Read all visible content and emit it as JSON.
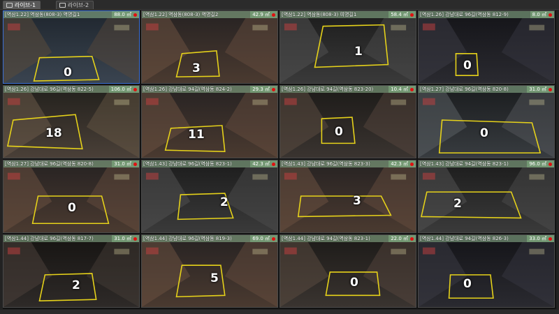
{
  "tabs": [
    {
      "label": "라이브-1",
      "active": true
    },
    {
      "label": "라이브-2",
      "active": false
    }
  ],
  "cameras": [
    {
      "name": "[역삼1.22] 역삼동(808-3) 역명길1",
      "area": "88.0 ㎡",
      "count": "0"
    },
    {
      "name": "[역삼1.22] 역삼동(808-3) 역명길2",
      "area": "42.9 ㎡",
      "count": "3"
    },
    {
      "name": "[역삼1.22] 역삼동(808-3) 여명길1",
      "area": "58.4 ㎡",
      "count": "1"
    },
    {
      "name": "[역삼1.26] 강남대로 96길(역삼동 812-9)",
      "area": "8.0 ㎡",
      "count": "0"
    },
    {
      "name": "[역삼1.26] 강남대로 96길(역삼동 822-5)",
      "area": "106.0 ㎡",
      "count": "18"
    },
    {
      "name": "[역삼1.26] 강남대로 94길(역삼동 824-2)",
      "area": "29.3 ㎡",
      "count": "11"
    },
    {
      "name": "[역삼1.26] 강남대로 94길(역삼동 823-20)",
      "area": "10.4 ㎡",
      "count": "0"
    },
    {
      "name": "[역삼1.27] 강남대로 96길(역삼동 820-8)",
      "area": "31.0 ㎡",
      "count": "0"
    },
    {
      "name": "[역삼1.27] 강남대로 96길(역삼동 820-8)",
      "area": "31.0 ㎡",
      "count": "0"
    },
    {
      "name": "[역삼1.43] 강남대로 96길(역삼동 823-1)",
      "area": "42.3 ㎡",
      "count": "2"
    },
    {
      "name": "[역삼1.43] 강남대로 96길(역삼동 823-3)",
      "area": "42.3 ㎡",
      "count": "3"
    },
    {
      "name": "[역삼1.43] 강남대로 94길(역삼동 823-1)",
      "area": "96.0 ㎡",
      "count": "2"
    },
    {
      "name": "[역삼1.44] 강남대로 96길(역삼동 817-7)",
      "area": "31.0 ㎡",
      "count": "2"
    },
    {
      "name": "[역삼1.44] 강남대로 96길(역삼동 819-3)",
      "area": "69.0 ㎡",
      "count": "5"
    },
    {
      "name": "[역삼1.44] 강남대로 94길(역삼동 823-1)",
      "area": "22.0 ㎡",
      "count": "0"
    },
    {
      "name": "[역삼1.44] 강남대로 94길(역삼동 826-3)",
      "area": "33.0 ㎡",
      "count": "0"
    }
  ],
  "colors": {
    "zone_outline": "#e6d21a",
    "header_bg": "#96be96",
    "alarm_dot": "#e01010",
    "selected_border": "#3b6fd6"
  }
}
